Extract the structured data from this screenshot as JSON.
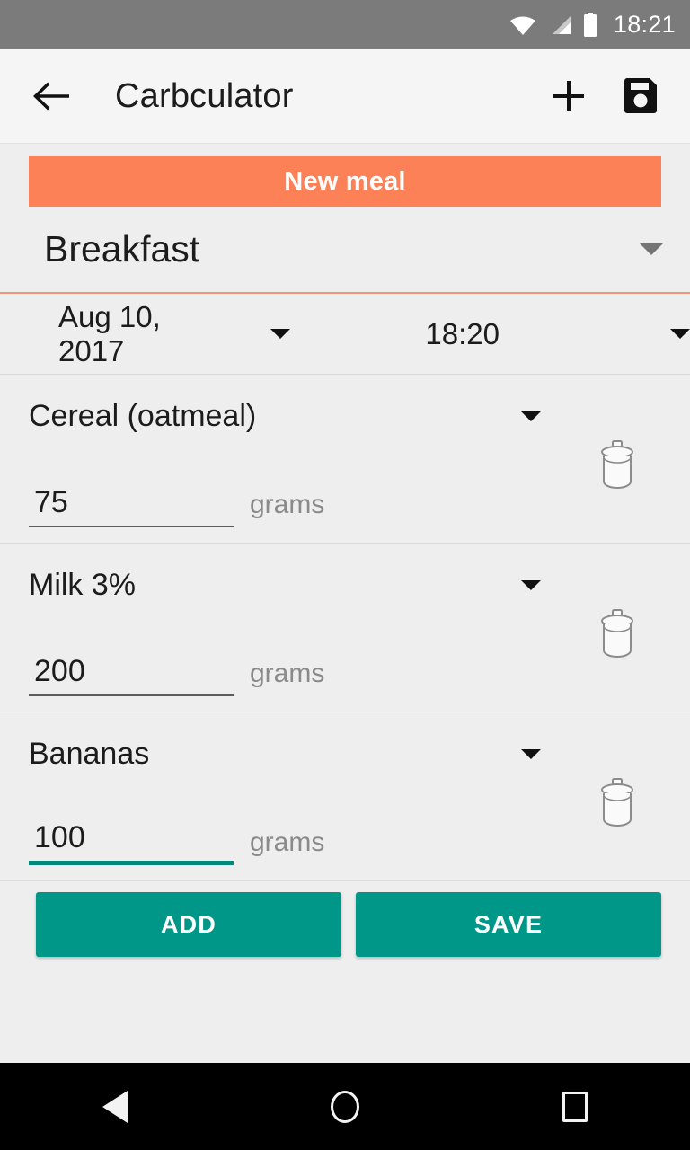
{
  "status_bar": {
    "time": "18:21",
    "icons": [
      "wifi-icon",
      "cellular-signal-icon",
      "battery-icon"
    ]
  },
  "app_bar": {
    "back_icon": "back-arrow-icon",
    "title": "Carbculator",
    "add_icon": "plus-icon",
    "save_icon": "floppy-disk-save-icon"
  },
  "banner": {
    "label": "New meal",
    "color": "#fc8156"
  },
  "meal_type": {
    "value": "Breakfast",
    "underline_color": "#f0977a"
  },
  "datetime": {
    "date": "Aug 10, 2017",
    "time": "18:20"
  },
  "unit_label": "grams",
  "foods": [
    {
      "name": "Cereal (oatmeal)",
      "amount": "75",
      "unit": "grams",
      "focused": false
    },
    {
      "name": "Milk 3%",
      "amount": "200",
      "unit": "grams",
      "focused": false
    },
    {
      "name": "Bananas",
      "amount": "100",
      "unit": "grams",
      "focused": true
    }
  ],
  "actions": {
    "add_label": "ADD",
    "save_label": "SAVE",
    "color": "#009688"
  },
  "nav_bar": {
    "back": "nav-back-icon",
    "home": "nav-home-icon",
    "recents": "nav-recents-icon"
  }
}
